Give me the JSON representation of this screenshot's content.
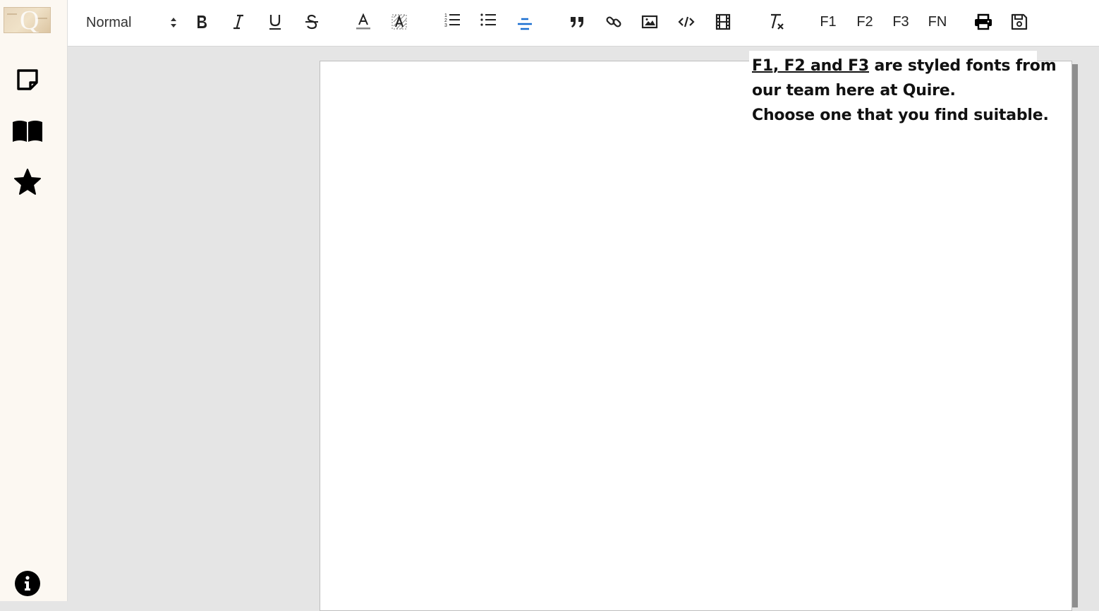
{
  "app": {
    "logo_letter": "Q"
  },
  "sidebar": {
    "items": [
      {
        "name": "notes",
        "icon": "sticky-note-icon"
      },
      {
        "name": "library",
        "icon": "open-book-icon"
      },
      {
        "name": "favorites",
        "icon": "star-icon"
      },
      {
        "name": "info",
        "icon": "info-circle-icon"
      }
    ]
  },
  "toolbar": {
    "style_select": {
      "value": "Normal"
    },
    "buttons": [
      {
        "label": "B",
        "icon": "bold-icon"
      },
      {
        "label": "I",
        "icon": "italic-icon"
      },
      {
        "label": "U",
        "icon": "underline-icon"
      },
      {
        "label": "S",
        "icon": "strikethrough-icon"
      },
      {
        "label": "A",
        "icon": "text-color-icon"
      },
      {
        "label": "A",
        "icon": "background-color-icon"
      },
      {
        "icon": "ordered-list-icon"
      },
      {
        "icon": "bullet-list-icon"
      },
      {
        "icon": "align-center-icon",
        "active": true
      },
      {
        "icon": "blockquote-icon"
      },
      {
        "icon": "link-icon"
      },
      {
        "icon": "image-icon"
      },
      {
        "icon": "code-icon"
      },
      {
        "icon": "video-icon"
      },
      {
        "icon": "clear-format-icon"
      }
    ],
    "font_buttons": [
      "F1",
      "F2",
      "F3",
      "FN"
    ],
    "print_icon": "print-icon",
    "save_icon": "save-icon",
    "active_color": "#1a6fd1"
  },
  "tooltip": {
    "highlight": "F1, F2 and F3",
    "line1_rest": " are styled fonts from",
    "line2": "our team here at Quire.",
    "line3": "Choose one that you find suitable."
  }
}
